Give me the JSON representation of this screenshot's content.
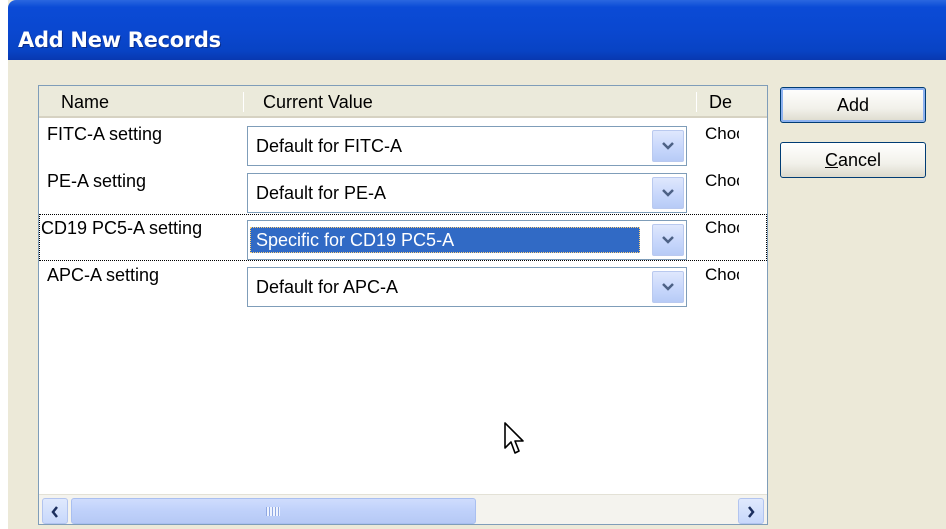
{
  "window": {
    "title": "Add New Records"
  },
  "list": {
    "columns": [
      "Name",
      "Current Value",
      "De"
    ],
    "rows": [
      {
        "name": "FITC-A setting",
        "value": "Default for FITC-A",
        "desc": "Choo",
        "selected": false
      },
      {
        "name": "PE-A setting",
        "value": "Default for PE-A",
        "desc": "Choo",
        "selected": false
      },
      {
        "name": "CD19 PC5-A setting",
        "value": "Specific for CD19 PC5-A",
        "desc": "Choo",
        "selected": true
      },
      {
        "name": "APC-A setting",
        "value": "Default for APC-A",
        "desc": "Choo",
        "selected": false
      }
    ]
  },
  "buttons": {
    "add": "Add",
    "cancel_mnemonic": "C",
    "cancel_rest": "ancel"
  },
  "icons": {
    "dropdown": "chevron-down-icon",
    "scroll_left": "arrow-left-icon",
    "scroll_right": "arrow-right-icon",
    "cursor": "mouse-cursor-icon"
  },
  "colors": {
    "title_bar": "#0a47cf",
    "selection": "#316ac5",
    "dialog_bg": "#ece9d8"
  }
}
